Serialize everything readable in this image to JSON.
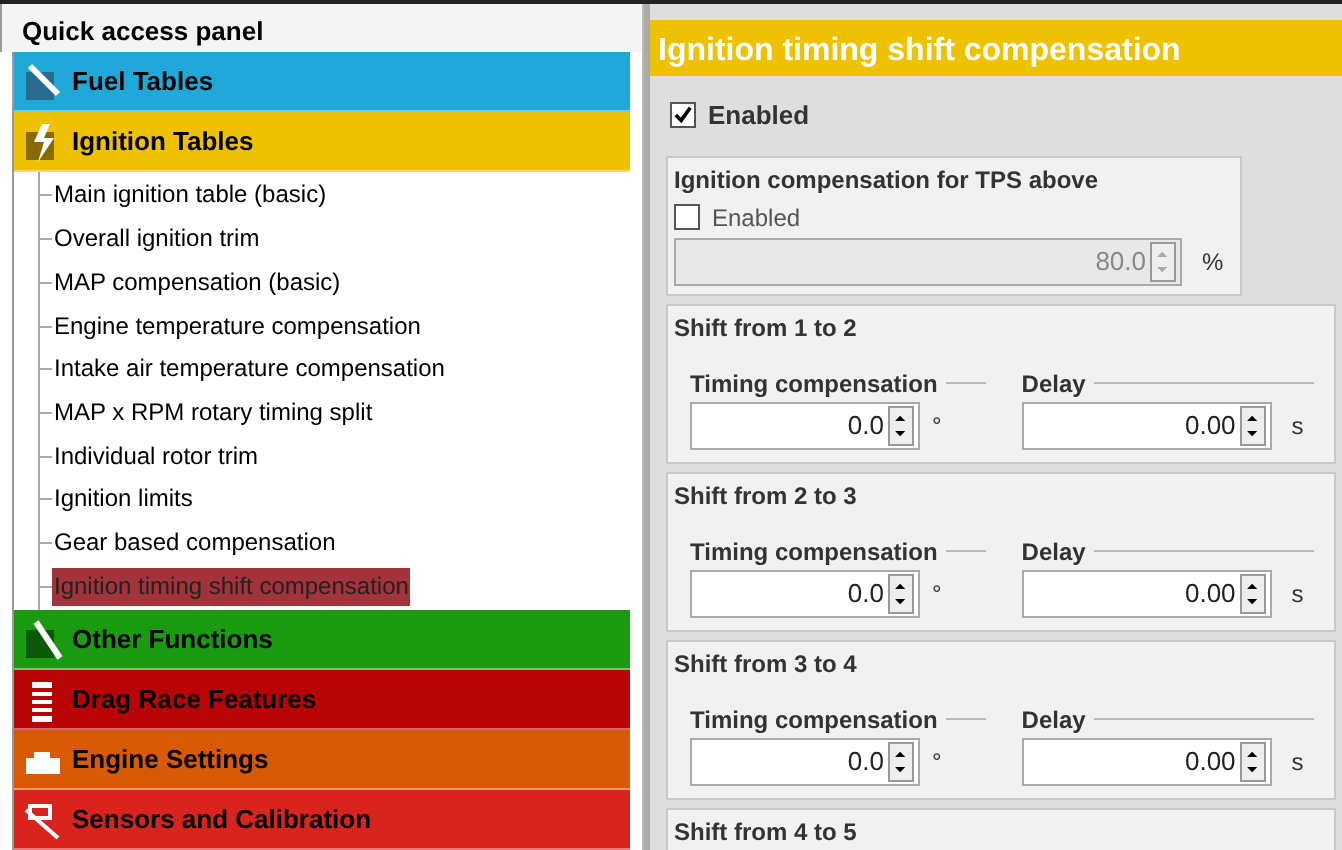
{
  "quick_access_panel": {
    "title": "Quick access panel",
    "categories": [
      {
        "label": "Fuel Tables",
        "color": "#1fa8d8"
      },
      {
        "label": "Ignition Tables",
        "color": "#eec200",
        "children": [
          {
            "label": "Main ignition table (basic)",
            "selected": false
          },
          {
            "label": "Overall ignition trim",
            "selected": false
          },
          {
            "label": "MAP compensation (basic)",
            "selected": false
          },
          {
            "label": "Engine temperature compensation",
            "selected": false
          },
          {
            "label": "Intake air temperature compensation",
            "selected": false
          },
          {
            "label": "MAP x RPM rotary timing split",
            "selected": false
          },
          {
            "label": "Individual rotor trim",
            "selected": false
          },
          {
            "label": "Ignition limits",
            "selected": false
          },
          {
            "label": "Gear based compensation",
            "selected": false
          },
          {
            "label": "Ignition timing shift compensation",
            "selected": true
          }
        ]
      },
      {
        "label": "Other Functions",
        "color": "#1a9a10"
      },
      {
        "label": "Drag Race Features",
        "color": "#b80404"
      },
      {
        "label": "Engine Settings",
        "color": "#d95a06"
      },
      {
        "label": "Sensors and Calibration",
        "color": "#d8241c"
      }
    ]
  },
  "settings": {
    "title": "Ignition timing shift compensation",
    "enabled": {
      "label": "Enabled",
      "checked": true
    },
    "tps_group": {
      "title": "Ignition compensation for TPS above",
      "enabled": {
        "label": "Enabled",
        "checked": false
      },
      "value": "80.0",
      "unit": "%",
      "disabled": true
    },
    "shift_groups": [
      {
        "title": "Shift from 1 to 2",
        "timing_label": "Timing compensation",
        "timing_value": "0.0",
        "timing_unit": "°",
        "delay_label": "Delay",
        "delay_value": "0.00",
        "delay_unit": "s"
      },
      {
        "title": "Shift from 2 to 3",
        "timing_label": "Timing compensation",
        "timing_value": "0.0",
        "timing_unit": "°",
        "delay_label": "Delay",
        "delay_value": "0.00",
        "delay_unit": "s"
      },
      {
        "title": "Shift from 3 to 4",
        "timing_label": "Timing compensation",
        "timing_value": "0.0",
        "timing_unit": "°",
        "delay_label": "Delay",
        "delay_value": "0.00",
        "delay_unit": "s"
      },
      {
        "title": "Shift from 4 to 5"
      }
    ]
  }
}
